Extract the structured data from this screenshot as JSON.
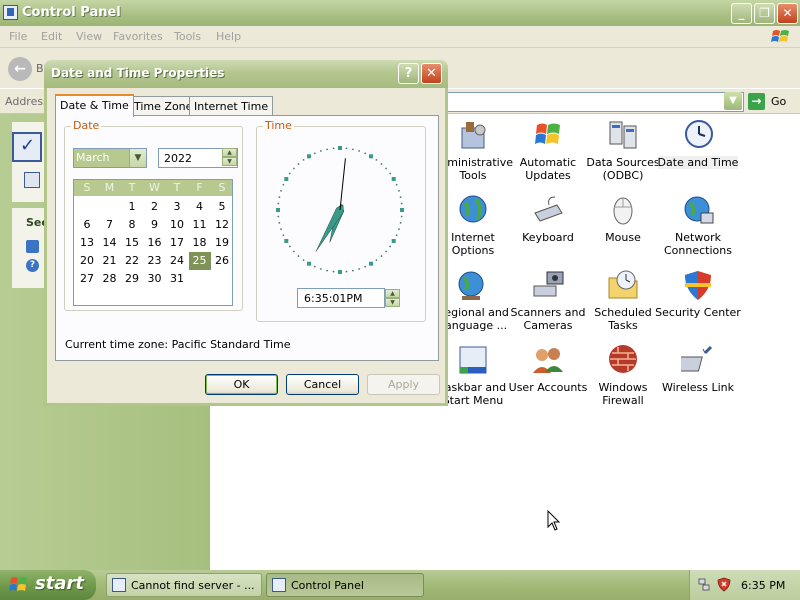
{
  "window": {
    "title": "Control Panel",
    "menu": [
      "File",
      "Edit",
      "View",
      "Favorites",
      "Tools",
      "Help"
    ],
    "back_label": "B",
    "address_label": "Address",
    "go_label": "Go",
    "left_pane": {
      "see_label": "See"
    }
  },
  "control_panel_icons": [
    {
      "label": "Administrative Tools",
      "icon": "admin-tools-icon",
      "selected": false
    },
    {
      "label": "Automatic Updates",
      "icon": "windows-flag-icon",
      "selected": false
    },
    {
      "label": "Data Sources (ODBC)",
      "icon": "database-icon",
      "selected": false
    },
    {
      "label": "Date and Time",
      "icon": "clock-icon",
      "selected": true
    },
    {
      "label": "Internet Options",
      "icon": "globe-icon",
      "selected": false
    },
    {
      "label": "Keyboard",
      "icon": "keyboard-icon",
      "selected": false
    },
    {
      "label": "Mouse",
      "icon": "mouse-icon",
      "selected": false
    },
    {
      "label": "Network Connections",
      "icon": "network-icon",
      "selected": false
    },
    {
      "label": "Regional and Language ...",
      "icon": "globe-clock-icon",
      "selected": false
    },
    {
      "label": "Scanners and Cameras",
      "icon": "scanner-icon",
      "selected": false
    },
    {
      "label": "Scheduled Tasks",
      "icon": "folder-clock-icon",
      "selected": false
    },
    {
      "label": "Security Center",
      "icon": "shield-icon",
      "selected": false
    },
    {
      "label": "Taskbar and Start Menu",
      "icon": "taskbar-icon",
      "selected": false
    },
    {
      "label": "User Accounts",
      "icon": "users-icon",
      "selected": false
    },
    {
      "label": "Windows Firewall",
      "icon": "firewall-icon",
      "selected": false
    },
    {
      "label": "Wireless Link",
      "icon": "wireless-icon",
      "selected": false
    }
  ],
  "dialog": {
    "title": "Date and Time Properties",
    "help_label": "?",
    "close_label": "✕",
    "tabs": [
      "Date & Time",
      "Time Zone",
      "Internet Time"
    ],
    "active_tab": 0,
    "date_group_label": "Date",
    "time_group_label": "Time",
    "month": "March",
    "year": "2022",
    "weekday_headers": [
      "S",
      "M",
      "T",
      "W",
      "T",
      "F",
      "S"
    ],
    "calendar_weeks": [
      [
        "",
        "",
        "1",
        "2",
        "3",
        "4",
        "5"
      ],
      [
        "6",
        "7",
        "8",
        "9",
        "10",
        "11",
        "12"
      ],
      [
        "13",
        "14",
        "15",
        "16",
        "17",
        "18",
        "19"
      ],
      [
        "20",
        "21",
        "22",
        "23",
        "24",
        "25",
        "26"
      ],
      [
        "27",
        "28",
        "29",
        "30",
        "31",
        "",
        ""
      ]
    ],
    "selected_day": "25",
    "time_value": "6:35:01PM",
    "clock": {
      "hour": 6,
      "minute": 35,
      "second": 1
    },
    "timezone_text": "Current time zone:  Pacific Standard Time",
    "buttons": {
      "ok": "OK",
      "cancel": "Cancel",
      "apply": "Apply"
    }
  },
  "taskbar": {
    "start_label": "start",
    "tasks": [
      {
        "label": "Cannot find server - ...",
        "active": false
      },
      {
        "label": "Control Panel",
        "active": true
      }
    ],
    "clock": "6:35 PM"
  },
  "colors": {
    "title_green": "#a9bf83",
    "accent_orange": "#e68b2c",
    "selection_green": "#7e9355",
    "close_red": "#c3411d"
  }
}
